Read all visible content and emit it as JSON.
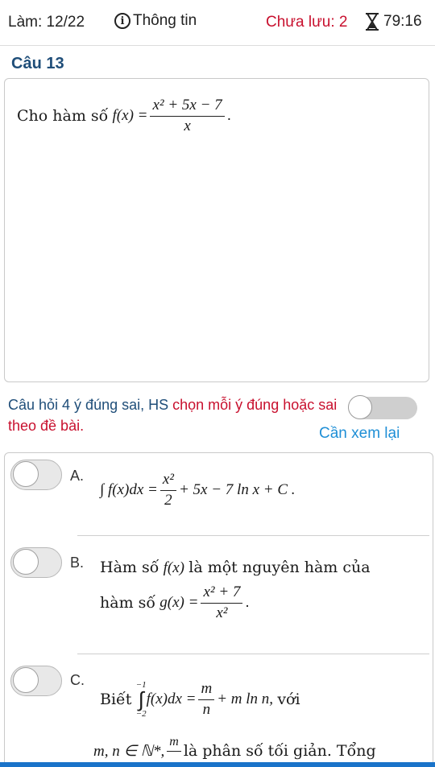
{
  "header": {
    "progress": "Làm: 12/22",
    "info": "Thông tin",
    "unsaved": "Chưa lưu: 2",
    "timer": "79:16"
  },
  "question": {
    "title": "Câu 13",
    "stem_text": "Cho hàm số",
    "stem_func": "f(x) =",
    "stem_numerator": "x² + 5x − 7",
    "stem_denominator": "x",
    "stem_end": "."
  },
  "instruction": {
    "part1": "Câu hỏi 4 ý đúng sai, HS ",
    "part2": "chọn mỗi ý đúng hoặc sai theo đề bài.",
    "review": "Cần xem lại"
  },
  "options": [
    {
      "letter": "A.",
      "expr_left": "∫ f(x)dx =",
      "num": "x²",
      "den": "2",
      "expr_right": "+ 5x − 7 ln x + C ."
    },
    {
      "letter": "B.",
      "line1_text": "Hàm số",
      "line1_func": "f(x)",
      "line1_rest": "là một nguyên hàm của",
      "line2_text": "hàm số",
      "line2_func": "g(x) =",
      "num": "x² + 7",
      "den": "x²",
      "end": "."
    },
    {
      "letter": "C.",
      "line1_text": "Biết",
      "upper": "−1",
      "lower": "−2",
      "integrand": "f(x)dx =",
      "num": "m",
      "den": "n",
      "rest": "+ m ln n,",
      "with": "với",
      "line2_math": "m, n ∈ ℕ*,",
      "num2": "m",
      "line2_rest": "là phân số tối giản. Tổng"
    }
  ],
  "colors": {
    "accent": "#1f4e79",
    "alert": "#c8102e",
    "link": "#1f8fd6"
  }
}
